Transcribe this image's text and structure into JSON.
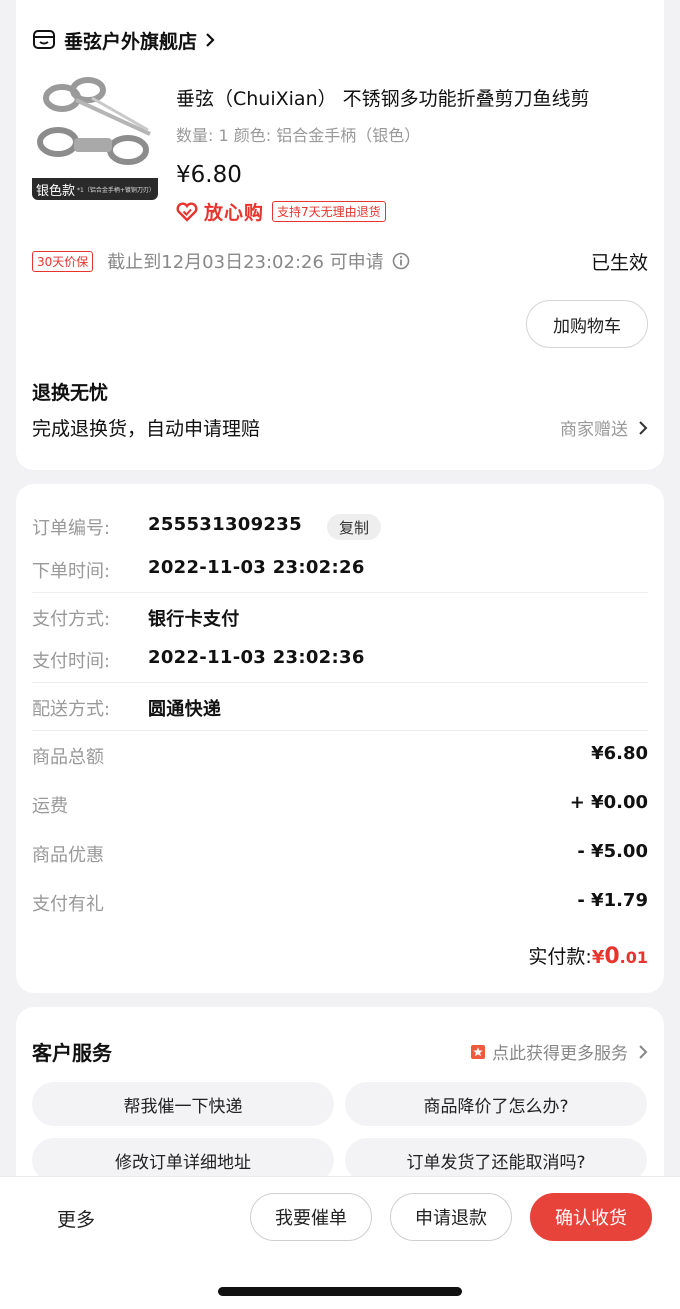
{
  "colors": {
    "accent": "#e8342e",
    "primary_button": "#e8433a",
    "background": "#f2f2f4"
  },
  "shop": {
    "name": "垂弦户外旗舰店",
    "icon": "store-icon"
  },
  "product": {
    "badge_main": "银色款",
    "badge_sub": "*1（铝合金手柄+镀铜刀刃）",
    "title": "垂弦（ChuiXian） 不锈钢多功能折叠剪刀鱼线剪",
    "spec": "数量: 1  颜色: 铝合金手柄（银色）",
    "price": "¥6.80",
    "assure_text": "放心购",
    "assure_tag": "支持7天无理由退货"
  },
  "price_protect": {
    "tag": "30天价保",
    "text": "截止到12月03日23:02:26 可申请",
    "status": "已生效"
  },
  "add_cart_label": "加购物车",
  "worry_free": {
    "title": "退换无忧",
    "desc": "完成退换货，自动申请理赔",
    "right": "商家赠送"
  },
  "order": {
    "number_label": "订单编号:",
    "number": "255531309235",
    "copy_label": "复制",
    "time_label": "下单时间:",
    "time": "2022-11-03 23:02:26",
    "pay_method_label": "支付方式:",
    "pay_method": "银行卡支付",
    "pay_time_label": "支付时间:",
    "pay_time": "2022-11-03 23:02:36",
    "ship_label": "配送方式:",
    "ship": "圆通快递"
  },
  "fees": [
    {
      "label": "商品总额",
      "value": "¥6.80"
    },
    {
      "label": "运费",
      "value": "+ ¥0.00"
    },
    {
      "label": "商品优惠",
      "value": "- ¥5.00"
    },
    {
      "label": "支付有礼",
      "value": "- ¥1.79"
    }
  ],
  "paid": {
    "label": "实付款:",
    "yen": "¥",
    "int": "0",
    "dec": ".01"
  },
  "service": {
    "title": "客户服务",
    "more": "点此获得更多服务",
    "faqs": [
      "帮我催一下快递",
      "商品降价了怎么办?",
      "修改订单详细地址",
      "订单发货了还能取消吗?"
    ]
  },
  "bottom": {
    "more": "更多",
    "urge": "我要催单",
    "refund": "申请退款",
    "confirm": "确认收货"
  }
}
